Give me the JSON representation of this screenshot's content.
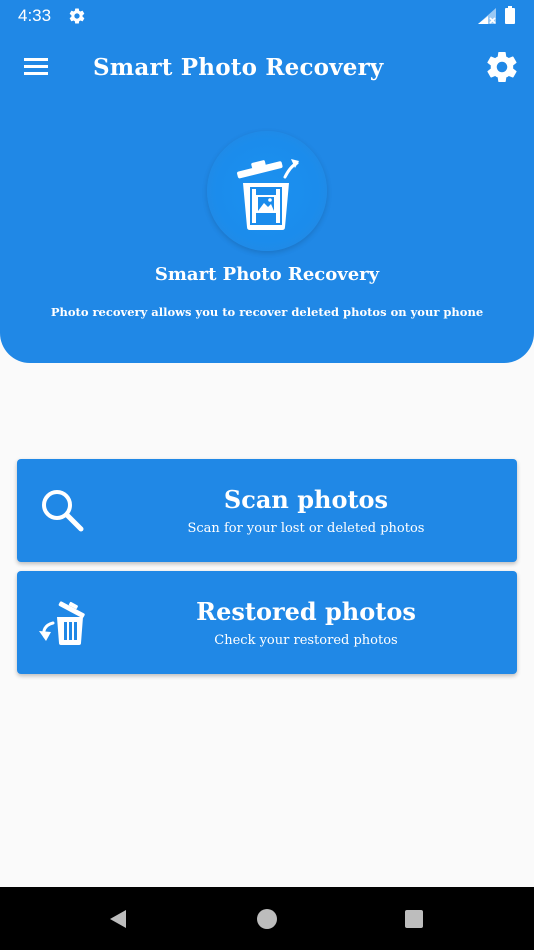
{
  "status_bar": {
    "time": "4:33",
    "icons": [
      "settings-gear-icon",
      "signal-icon",
      "battery-icon"
    ]
  },
  "app_bar": {
    "title": "Smart Photo Recovery",
    "menu_icon": "hamburger-menu-icon",
    "settings_icon": "gear-icon"
  },
  "hero": {
    "icon": "trash-photo-restore-icon",
    "title": "Smart Photo Recovery",
    "subtitle": "Photo recovery allows you to recover deleted photos on your phone"
  },
  "actions": [
    {
      "icon": "search-icon",
      "title": "Scan photos",
      "subtitle": "Scan for your lost or deleted photos"
    },
    {
      "icon": "restore-trash-icon",
      "title": "Restored photos",
      "subtitle": "Check your restored photos"
    }
  ],
  "nav_bar": {
    "icons": [
      "back-icon",
      "home-icon",
      "recents-icon"
    ]
  },
  "colors": {
    "primary": "#2088e6",
    "background": "#fafafa",
    "on_primary": "#ffffff",
    "nav_bar": "#000000"
  }
}
